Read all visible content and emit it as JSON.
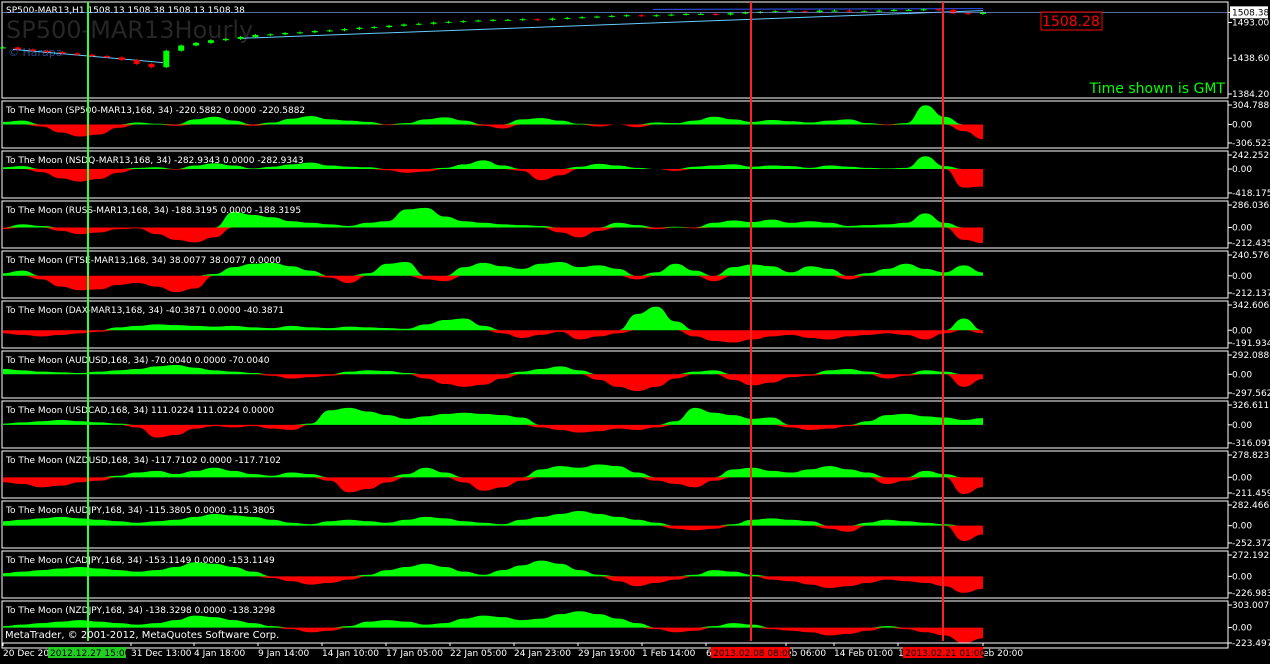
{
  "window": {
    "symbol_header": "SP500-MAR13,H1  1508.13 1508.38 1508.13 1508.38",
    "watermark": "SP500-MAR13Hourly",
    "copyright_small": "© Harapa",
    "gmt_note": "Time shown is GMT",
    "footer": "MetaTrader, © 2001-2012, MetaQuotes Software Corp."
  },
  "colors": {
    "background": "#000000",
    "pos": "#00ff00",
    "neg": "#ff0000",
    "grid": "#ffffff",
    "trend": "#66ccff",
    "vline_green": "#33ff33",
    "vline_red": "#ff2222"
  },
  "chart_data": [
    {
      "type": "line",
      "title": "SP500-MAR13,H1",
      "yticks": [
        "1508.38",
        "1493.00",
        "1438.60",
        "1384.20"
      ],
      "price_label": "1508.28",
      "ylim": [
        1384.2,
        1515
      ],
      "series": [
        {
          "values": [
            1455,
            1452,
            1450,
            1448,
            1446,
            1444,
            1442,
            1440,
            1436,
            1430,
            1425,
            1450,
            1458,
            1462,
            1466,
            1468,
            1471,
            1474,
            1475,
            1477,
            1478,
            1480,
            1481,
            1483,
            1485,
            1486,
            1488,
            1490,
            1491,
            1493,
            1494,
            1495,
            1496,
            1497,
            1497,
            1498,
            1497,
            1499,
            1500,
            1501,
            1502,
            1503,
            1504,
            1503,
            1504,
            1505,
            1506,
            1506,
            1505,
            1507,
            1508,
            1509,
            1510,
            1510,
            1509,
            1511,
            1511,
            1510,
            1510,
            1511,
            1512,
            1512,
            1513,
            1512,
            1507,
            1506,
            1508
          ]
        }
      ]
    },
    {
      "type": "area",
      "title": "To The Moon (SP500-MAR13,168, 34) -220.5882 0.0000 -220.5882",
      "yticks": [
        "304.7886",
        "0.00",
        "-306.523"
      ],
      "ylim": [
        -306.523,
        304.7886
      ],
      "values": [
        40,
        60,
        -30,
        -120,
        -180,
        -150,
        -50,
        30,
        10,
        -20,
        80,
        120,
        60,
        -20,
        30,
        90,
        130,
        80,
        60,
        40,
        -10,
        20,
        80,
        110,
        60,
        -20,
        -60,
        80,
        100,
        60,
        10,
        -30,
        0,
        -40,
        30,
        20,
        60,
        120,
        80,
        40,
        70,
        50,
        30,
        60,
        80,
        20,
        -10,
        20,
        300,
        120,
        -100,
        -220
      ]
    },
    {
      "type": "area",
      "title": "To The Moon (NSDQ-MAR13,168, 34) -282.9343 0.0000 -282.9343",
      "yticks": [
        "242.2526",
        "0.00",
        "-418.175"
      ],
      "ylim": [
        -418.175,
        242.2526
      ],
      "values": [
        30,
        50,
        -50,
        -150,
        -200,
        -160,
        -60,
        20,
        30,
        -10,
        60,
        100,
        60,
        10,
        40,
        80,
        110,
        60,
        40,
        30,
        -20,
        -60,
        -40,
        20,
        80,
        150,
        60,
        -30,
        -180,
        -100,
        40,
        90,
        60,
        20,
        0,
        -30,
        40,
        60,
        80,
        40,
        60,
        50,
        20,
        60,
        40,
        20,
        10,
        20,
        220,
        50,
        -300,
        -283
      ]
    },
    {
      "type": "area",
      "title": "To The Moon (RUSS-MAR13,168, 34) -188.3195 0.0000 -188.3195",
      "yticks": [
        "286.0362",
        "0.00",
        "-212.435"
      ],
      "ylim": [
        -212.435,
        286.0362
      ],
      "values": [
        -20,
        40,
        20,
        -40,
        -80,
        -60,
        -20,
        -10,
        -80,
        -150,
        -180,
        -120,
        200,
        160,
        130,
        80,
        60,
        40,
        20,
        60,
        80,
        230,
        250,
        140,
        80,
        60,
        40,
        30,
        20,
        -60,
        -120,
        -40,
        60,
        30,
        -20,
        10,
        -10,
        60,
        90,
        70,
        100,
        60,
        80,
        60,
        20,
        30,
        40,
        60,
        180,
        60,
        -150,
        -188
      ]
    },
    {
      "type": "area",
      "title": "To The Moon (FTSE-MAR13,168, 34) 38.0077 38.0077 0.0000",
      "yticks": [
        "240.5761",
        "0.00",
        "-212.137"
      ],
      "ylim": [
        -212.137,
        240.5761
      ],
      "values": [
        30,
        60,
        -40,
        -120,
        -160,
        -150,
        -100,
        -80,
        -120,
        -180,
        -140,
        20,
        100,
        140,
        150,
        110,
        60,
        -20,
        -80,
        30,
        140,
        160,
        -40,
        -60,
        100,
        150,
        110,
        80,
        140,
        160,
        100,
        120,
        80,
        -40,
        40,
        140,
        60,
        -60,
        100,
        130,
        110,
        40,
        110,
        80,
        -40,
        30,
        80,
        140,
        80,
        40,
        120,
        38
      ]
    },
    {
      "type": "area",
      "title": "To The Moon (DAX-MAR13,168, 34) -40.3871 0.0000 -40.3871",
      "yticks": [
        "342.6067",
        "0.00",
        "-191.934"
      ],
      "ylim": [
        -191.934,
        342.6067
      ],
      "values": [
        -40,
        -60,
        -80,
        -60,
        -40,
        -20,
        40,
        60,
        80,
        70,
        60,
        50,
        60,
        40,
        30,
        60,
        40,
        30,
        50,
        40,
        30,
        20,
        80,
        140,
        160,
        60,
        -40,
        -100,
        -60,
        -20,
        -120,
        -80,
        -40,
        220,
        320,
        120,
        -80,
        -140,
        -160,
        -120,
        -80,
        -60,
        -100,
        -120,
        -80,
        -60,
        -40,
        -60,
        -120,
        -40,
        160,
        -40
      ]
    },
    {
      "type": "area",
      "title": "To The Moon (AUDUSD,168, 34) -70.0040 0.0000 -70.0040",
      "yticks": [
        "292.0886",
        "0.00",
        "-297.562"
      ],
      "ylim": [
        -297.562,
        292.0886
      ],
      "values": [
        80,
        60,
        40,
        30,
        20,
        40,
        60,
        80,
        120,
        140,
        100,
        60,
        40,
        20,
        -20,
        -60,
        -40,
        -20,
        40,
        60,
        50,
        20,
        -60,
        -140,
        -180,
        -150,
        -60,
        40,
        80,
        120,
        60,
        -80,
        -180,
        -240,
        -180,
        -60,
        40,
        60,
        -80,
        -160,
        -120,
        -40,
        -20,
        60,
        80,
        40,
        -60,
        -20,
        60,
        40,
        -180,
        -70
      ]
    },
    {
      "type": "area",
      "title": "To The Moon (USDCAD,168, 34) 111.0224 111.0224 0.0000",
      "yticks": [
        "326.611",
        "0.00",
        "-316.0919"
      ],
      "ylim": [
        -316.0919,
        326.611
      ],
      "values": [
        20,
        40,
        60,
        80,
        60,
        40,
        20,
        -40,
        -200,
        -160,
        -60,
        -20,
        -40,
        -20,
        -60,
        -80,
        20,
        240,
        280,
        220,
        160,
        100,
        140,
        180,
        200,
        180,
        160,
        120,
        -40,
        -80,
        -120,
        -100,
        -60,
        -80,
        -40,
        60,
        280,
        200,
        160,
        100,
        120,
        -40,
        -80,
        -60,
        -20,
        60,
        160,
        180,
        140,
        120,
        80,
        111
      ]
    },
    {
      "type": "area",
      "title": "To The Moon (NZDUSD,168, 34) -117.7102 0.0000 -117.7102",
      "yticks": [
        "278.8237",
        "0.00",
        "-211.459"
      ],
      "ylim": [
        -211.459,
        278.8237
      ],
      "values": [
        -60,
        -80,
        -120,
        -100,
        -60,
        -40,
        20,
        60,
        80,
        40,
        80,
        120,
        80,
        40,
        20,
        60,
        40,
        -40,
        -180,
        -140,
        -60,
        40,
        120,
        60,
        -60,
        -160,
        -120,
        -40,
        100,
        140,
        120,
        160,
        140,
        60,
        -40,
        -80,
        -120,
        -40,
        100,
        120,
        80,
        60,
        100,
        140,
        100,
        60,
        -80,
        -40,
        80,
        40,
        -200,
        -118
      ]
    },
    {
      "type": "area",
      "title": "To The Moon (AUDJPY,168, 34) -115.3805 0.0000 -115.3805",
      "yticks": [
        "282.4665",
        "0.00",
        "-252.3725"
      ],
      "ylim": [
        -252.3725,
        282.4665
      ],
      "values": [
        60,
        80,
        100,
        120,
        100,
        80,
        60,
        40,
        60,
        80,
        120,
        160,
        140,
        120,
        80,
        40,
        20,
        60,
        80,
        60,
        40,
        80,
        120,
        100,
        60,
        40,
        20,
        80,
        120,
        160,
        200,
        160,
        120,
        80,
        40,
        -40,
        -60,
        -40,
        20,
        80,
        100,
        80,
        60,
        -40,
        -80,
        40,
        80,
        60,
        40,
        20,
        -200,
        -115
      ]
    },
    {
      "type": "area",
      "title": "To The Moon (CADJPY,168, 34) -153.1149 0.0000 -153.1149",
      "yticks": [
        "272.1922",
        "0.00",
        "-226.983"
      ],
      "ylim": [
        -226.983,
        272.1922
      ],
      "values": [
        40,
        60,
        80,
        100,
        120,
        100,
        80,
        60,
        80,
        120,
        180,
        160,
        120,
        60,
        -20,
        -60,
        -100,
        -80,
        -40,
        20,
        80,
        120,
        160,
        120,
        60,
        20,
        80,
        140,
        200,
        160,
        80,
        20,
        -60,
        -120,
        -80,
        -40,
        20,
        80,
        60,
        20,
        -40,
        -60,
        -100,
        -140,
        -120,
        -80,
        -40,
        -60,
        -80,
        -120,
        -200,
        -153
      ]
    },
    {
      "type": "area",
      "title": "To The Moon (NZDJPY,168, 34) -138.3298 0.0000 -138.3298",
      "yticks": [
        "303.0079",
        "0.00",
        "-223.497"
      ],
      "ylim": [
        -223.497,
        303.0079
      ],
      "values": [
        20,
        40,
        60,
        80,
        100,
        80,
        60,
        40,
        60,
        100,
        160,
        140,
        100,
        60,
        20,
        -20,
        -60,
        -40,
        20,
        80,
        100,
        80,
        40,
        60,
        120,
        160,
        140,
        100,
        120,
        180,
        220,
        180,
        120,
        60,
        -20,
        -60,
        -40,
        20,
        60,
        40,
        -20,
        -40,
        -60,
        -100,
        -80,
        -40,
        20,
        -20,
        -60,
        -100,
        -200,
        -138
      ]
    }
  ],
  "time_axis": {
    "labels": [
      "20 Dec 2012",
      "31 Dec 13:00",
      "4 Jan 18:00",
      "9 Jan 14:00",
      "14 Jan 10:00",
      "17 Jan 05:00",
      "22 Jan 05:00",
      "24 Jan 23:00",
      "29 Jan 19:00",
      "1 Feb 14:00",
      "6",
      "eb 06:00",
      "14 Feb 01:00",
      "19",
      "eb 20:00"
    ],
    "highlight_green": "2012.12.27 15:00",
    "highlight_red_1": "2013.02.08 08:00",
    "highlight_red_2": "2013.02.21 01:00"
  }
}
